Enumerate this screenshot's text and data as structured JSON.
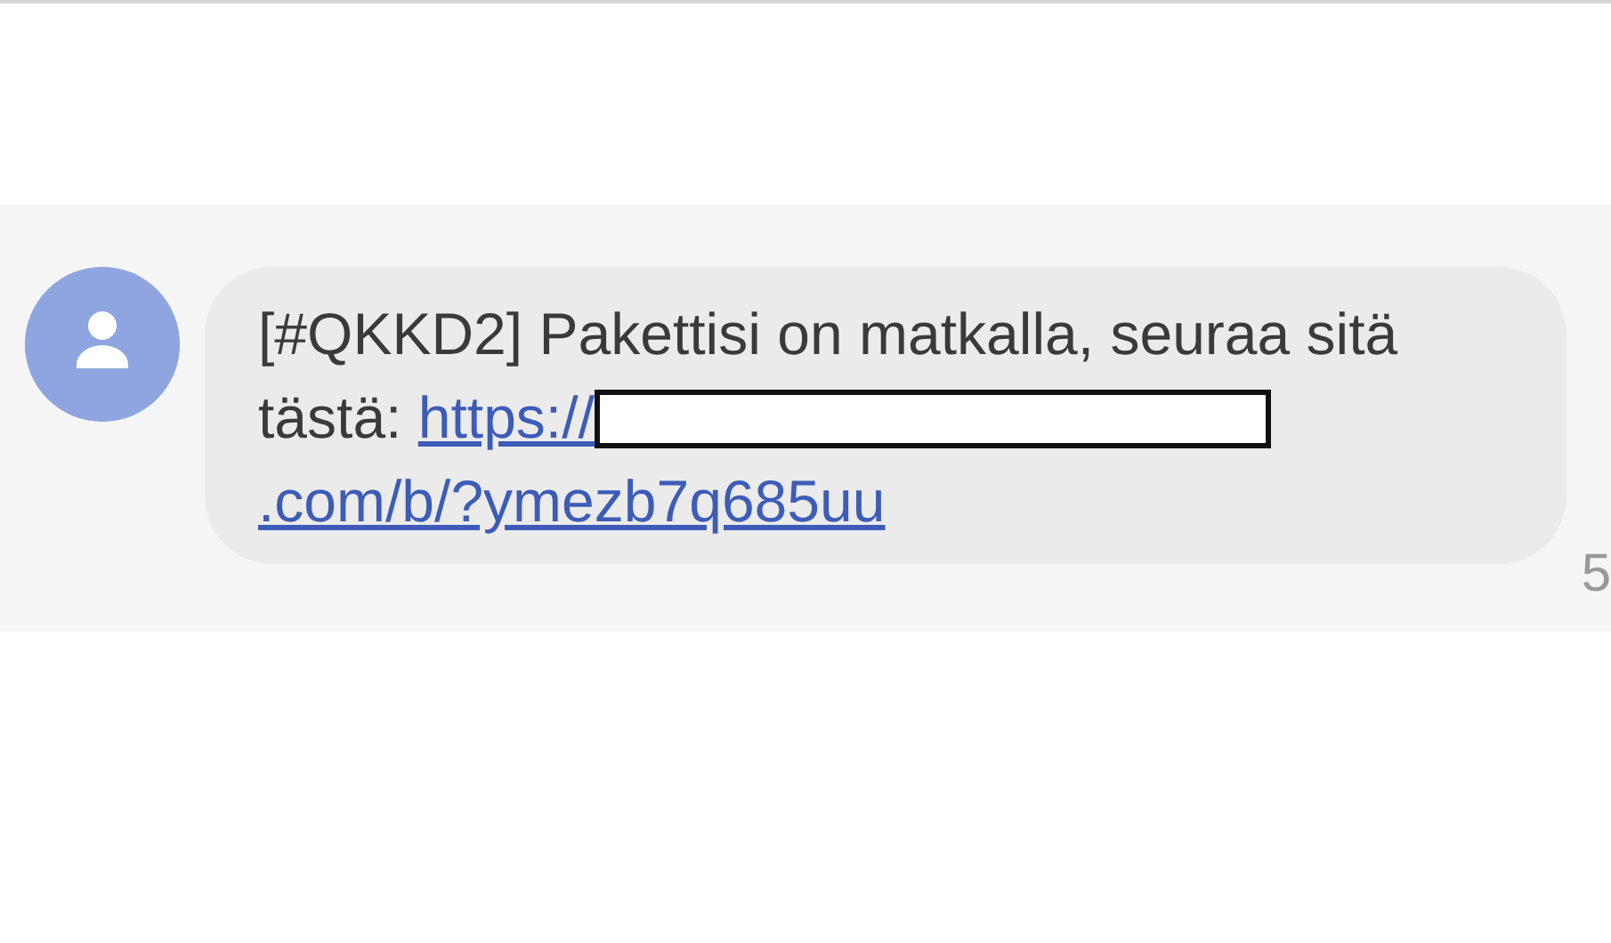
{
  "message": {
    "text": "[#QKKD2] Pakettisi on matkalla, seuraa sitä tästä:",
    "link_start": "https://",
    "redacted": true,
    "link_end": ".com/b/?ymezb7q685uu",
    "time": "5"
  }
}
